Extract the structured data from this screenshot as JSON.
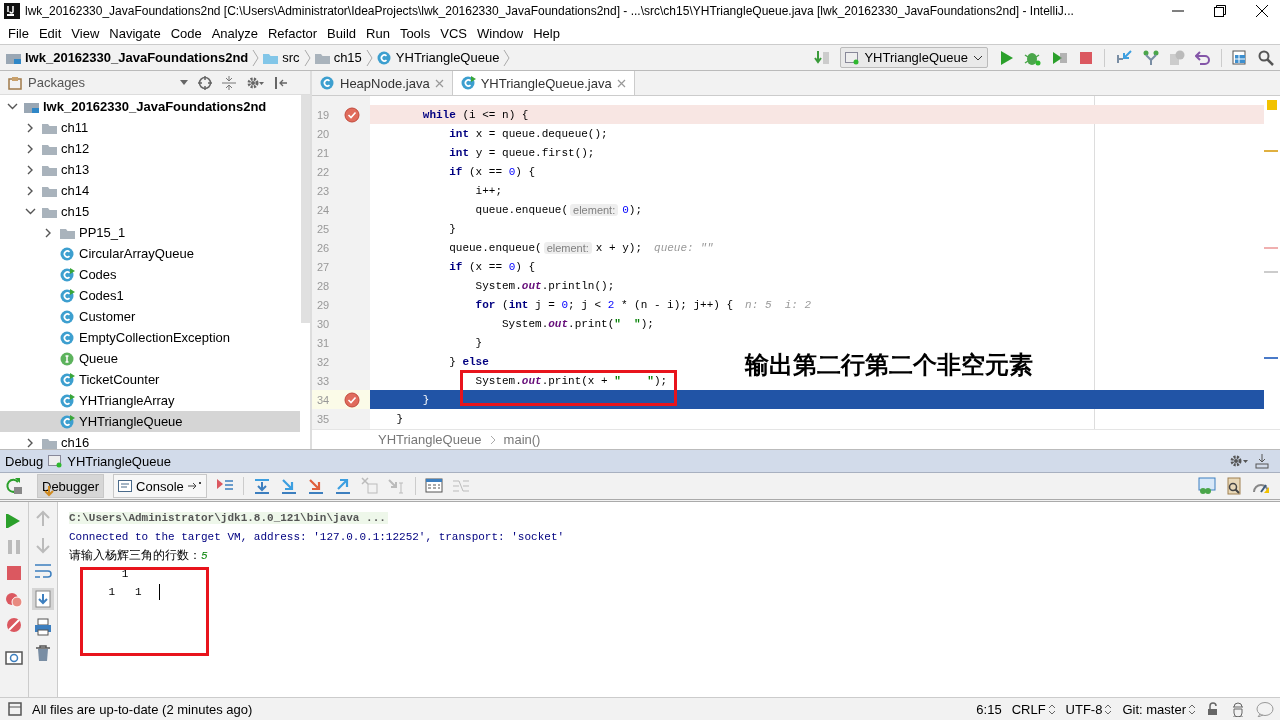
{
  "window": {
    "title": "lwk_20162330_JavaFoundations2nd [C:\\Users\\Administrator\\IdeaProjects\\lwk_20162330_JavaFoundations2nd] - ...\\src\\ch15\\YHTriangleQueue.java [lwk_20162330_JavaFoundations2nd] - IntelliJ..."
  },
  "menu": [
    "File",
    "Edit",
    "View",
    "Navigate",
    "Code",
    "Analyze",
    "Refactor",
    "Build",
    "Run",
    "Tools",
    "VCS",
    "Window",
    "Help"
  ],
  "nav_path": [
    {
      "kind": "module",
      "label": "lwk_20162330_JavaFoundations2nd"
    },
    {
      "kind": "source",
      "label": "src"
    },
    {
      "kind": "folder",
      "label": "ch15"
    },
    {
      "kind": "class",
      "label": "YHTriangleQueue"
    }
  ],
  "run_config": "YHTriangleQueue",
  "project": {
    "view": "Packages",
    "tree": [
      {
        "kind": "module",
        "label": "lwk_20162330_JavaFoundations2nd",
        "expanded": true,
        "selected": false,
        "children": [
          {
            "kind": "folder",
            "label": "ch11",
            "expanded": false,
            "selected": false
          },
          {
            "kind": "folder",
            "label": "ch12",
            "expanded": false,
            "selected": false
          },
          {
            "kind": "folder",
            "label": "ch13",
            "expanded": false,
            "selected": false
          },
          {
            "kind": "folder",
            "label": "ch14",
            "expanded": false,
            "selected": false
          },
          {
            "kind": "folder",
            "label": "ch15",
            "expanded": true,
            "selected": false,
            "children": [
              {
                "kind": "folder",
                "label": "PP15_1",
                "expanded": false,
                "selected": false
              },
              {
                "kind": "class",
                "label": "CircularArrayQueue",
                "selected": false
              },
              {
                "kind": "main_class",
                "label": "Codes",
                "selected": false
              },
              {
                "kind": "main_class",
                "label": "Codes1",
                "selected": false
              },
              {
                "kind": "class",
                "label": "Customer",
                "selected": false
              },
              {
                "kind": "class",
                "label": "EmptyCollectionException",
                "selected": false
              },
              {
                "kind": "interface",
                "label": "Queue",
                "selected": false
              },
              {
                "kind": "main_class",
                "label": "TicketCounter",
                "selected": false
              },
              {
                "kind": "main_class",
                "label": "YHTriangleArray",
                "selected": false
              },
              {
                "kind": "main_class",
                "label": "YHTriangleQueue",
                "selected": true
              }
            ]
          },
          {
            "kind": "folder",
            "label": "ch16",
            "expanded": false,
            "selected": false
          }
        ]
      }
    ]
  },
  "editor": {
    "tabs": [
      {
        "kind": "class",
        "label": "HeapNode.java",
        "selected": false
      },
      {
        "kind": "main_class",
        "label": "YHTriangleQueue.java",
        "selected": true
      }
    ],
    "lines": [
      {
        "number": "19",
        "breakpoint": true,
        "current": false,
        "tokens": [
          {
            "kind": "keyword",
            "text": "        while"
          },
          {
            "kind": "plain",
            "text": " (i <= n) {"
          }
        ]
      },
      {
        "number": "20",
        "breakpoint": false,
        "current": false,
        "tokens": [
          {
            "kind": "keyword",
            "text": "            int"
          },
          {
            "kind": "plain",
            "text": " x = queue.dequeue();"
          }
        ]
      },
      {
        "number": "21",
        "breakpoint": false,
        "current": false,
        "tokens": [
          {
            "kind": "keyword",
            "text": "            int"
          },
          {
            "kind": "plain",
            "text": " y = queue.first();"
          }
        ]
      },
      {
        "number": "22",
        "breakpoint": false,
        "current": false,
        "tokens": [
          {
            "kind": "keyword",
            "text": "            if"
          },
          {
            "kind": "plain",
            "text": " (x == "
          },
          {
            "kind": "number",
            "text": "0"
          },
          {
            "kind": "plain",
            "text": ") {"
          }
        ]
      },
      {
        "number": "23",
        "breakpoint": false,
        "current": false,
        "tokens": [
          {
            "kind": "plain",
            "text": "                i++;"
          }
        ]
      },
      {
        "number": "24",
        "breakpoint": false,
        "current": false,
        "tokens": [
          {
            "kind": "plain",
            "text": "                queue.enqueue("
          },
          {
            "kind": "hint",
            "text": "element:"
          },
          {
            "kind": "number",
            "text": "0"
          },
          {
            "kind": "plain",
            "text": ");"
          }
        ]
      },
      {
        "number": "25",
        "breakpoint": false,
        "current": false,
        "tokens": [
          {
            "kind": "plain",
            "text": "            }"
          }
        ]
      },
      {
        "number": "26",
        "breakpoint": false,
        "current": false,
        "tokens": [
          {
            "kind": "plain",
            "text": "            queue.enqueue("
          },
          {
            "kind": "hint",
            "text": "element:"
          },
          {
            "kind": "plain",
            "text": "x + y);"
          },
          {
            "kind": "value",
            "text": "queue: \"\""
          }
        ]
      },
      {
        "number": "27",
        "breakpoint": false,
        "current": false,
        "tokens": [
          {
            "kind": "keyword",
            "text": "            if"
          },
          {
            "kind": "plain",
            "text": " (x == "
          },
          {
            "kind": "number",
            "text": "0"
          },
          {
            "kind": "plain",
            "text": ") {"
          }
        ]
      },
      {
        "number": "28",
        "breakpoint": false,
        "current": false,
        "tokens": [
          {
            "kind": "plain",
            "text": "                System."
          },
          {
            "kind": "field",
            "text": "out"
          },
          {
            "kind": "plain",
            "text": ".println();"
          }
        ]
      },
      {
        "number": "29",
        "breakpoint": false,
        "current": false,
        "tokens": [
          {
            "kind": "keyword",
            "text": "                for"
          },
          {
            "kind": "plain",
            "text": " ("
          },
          {
            "kind": "keyword",
            "text": "int"
          },
          {
            "kind": "plain",
            "text": " j = "
          },
          {
            "kind": "number",
            "text": "0"
          },
          {
            "kind": "plain",
            "text": "; j < "
          },
          {
            "kind": "number",
            "text": "2"
          },
          {
            "kind": "plain",
            "text": " * (n - i); j++) {"
          },
          {
            "kind": "value",
            "text": "n: 5  i: 2"
          }
        ]
      },
      {
        "number": "30",
        "breakpoint": false,
        "current": false,
        "tokens": [
          {
            "kind": "plain",
            "text": "                    System."
          },
          {
            "kind": "field",
            "text": "out"
          },
          {
            "kind": "plain",
            "text": ".print("
          },
          {
            "kind": "string",
            "text": "\"  \""
          },
          {
            "kind": "plain",
            "text": ");"
          }
        ]
      },
      {
        "number": "31",
        "breakpoint": false,
        "current": false,
        "tokens": [
          {
            "kind": "plain",
            "text": "                }"
          }
        ]
      },
      {
        "number": "32",
        "breakpoint": false,
        "current": false,
        "tokens": [
          {
            "kind": "plain",
            "text": "            } "
          },
          {
            "kind": "keyword",
            "text": "else"
          }
        ]
      },
      {
        "number": "33",
        "breakpoint": false,
        "current": false,
        "tokens": [
          {
            "kind": "plain",
            "text": "                System."
          },
          {
            "kind": "field",
            "text": "out"
          },
          {
            "kind": "plain",
            "text": ".print(x + "
          },
          {
            "kind": "string",
            "text": "\"    \""
          },
          {
            "kind": "plain",
            "text": ");"
          }
        ]
      },
      {
        "number": "34",
        "breakpoint": true,
        "current": true,
        "tokens": [
          {
            "kind": "plain",
            "text": "        }"
          }
        ]
      },
      {
        "number": "35",
        "breakpoint": false,
        "current": false,
        "tokens": [
          {
            "kind": "plain",
            "text": "    }"
          }
        ]
      }
    ],
    "breadcrumbs": [
      "YHTriangleQueue",
      "main()"
    ],
    "annotation": "输出第二行第二个非空元素"
  },
  "debug": {
    "title": "Debug",
    "session": "YHTriangleQueue",
    "tabs": [
      {
        "label": "Debugger",
        "selected": false
      },
      {
        "label": "Console",
        "selected": true
      }
    ],
    "console": [
      {
        "kind": "command",
        "text": "C:\\Users\\Administrator\\jdk1.8.0_121\\bin\\java ..."
      },
      {
        "kind": "system",
        "text": "Connected to the target VM, address: '127.0.0.1:12252', transport: 'socket'"
      },
      {
        "kind": "prompt",
        "text": "请输入杨辉三角的行数：",
        "input": "5"
      },
      {
        "kind": "output",
        "text": "        1",
        "cursor": false
      },
      {
        "kind": "output",
        "text": "      1   1",
        "cursor": true
      }
    ]
  },
  "status_bar": {
    "message": "All files are up-to-date (2 minutes ago)",
    "position": "6:15",
    "line_separator": "CRLF",
    "encoding": "UTF-8",
    "vcs": "Git: master"
  }
}
